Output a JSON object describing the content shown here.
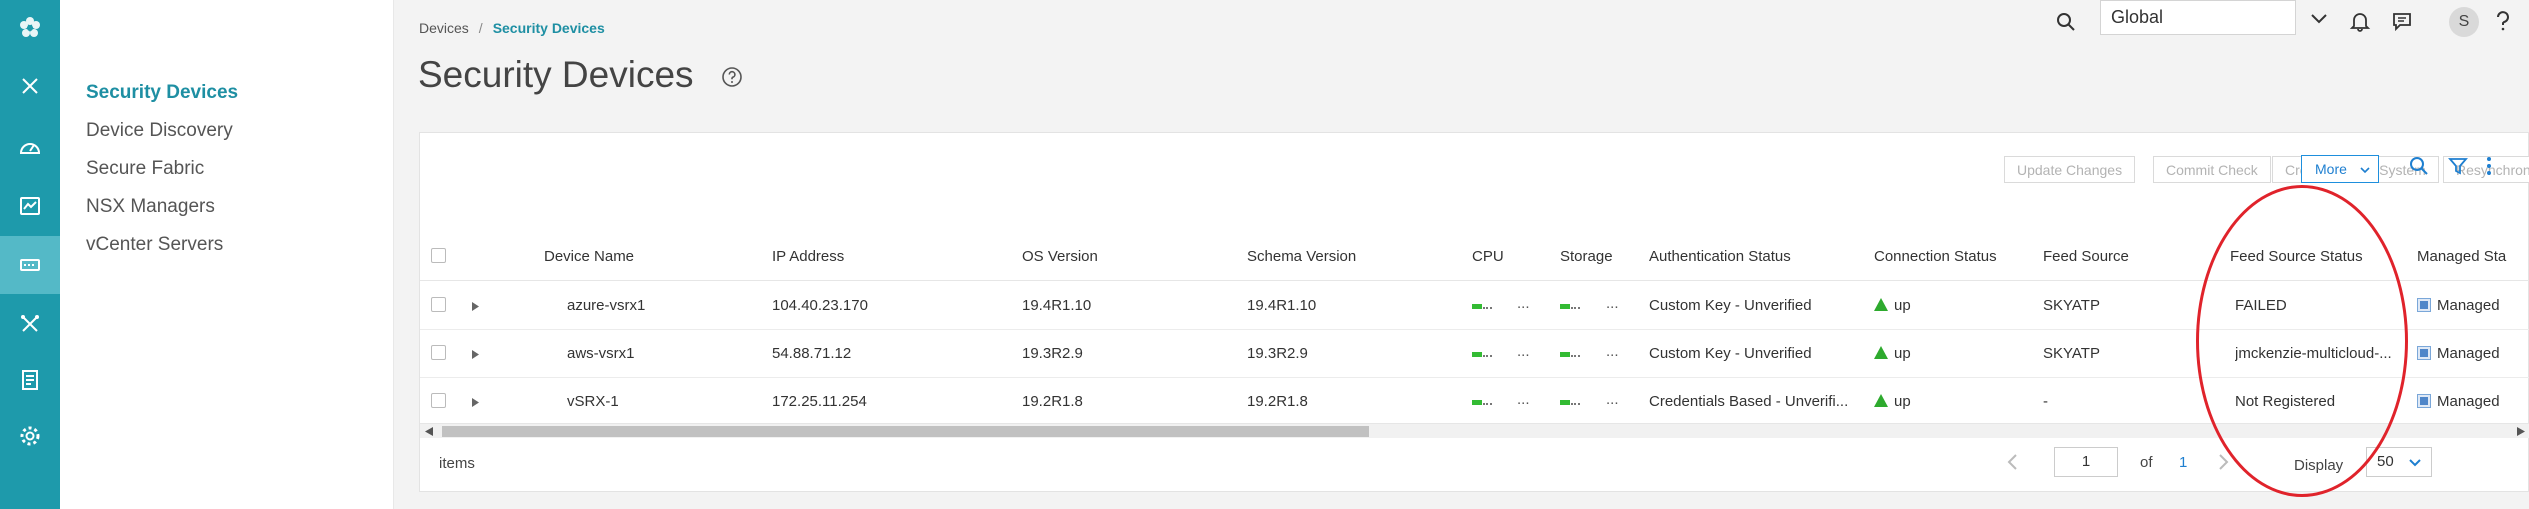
{
  "colors": {
    "rail_bg": "#1e9aab",
    "rail_active": "#54b9c7",
    "accent": "#1e8fa3",
    "link_blue": "#1e7fd0",
    "status_up": "#2eaa2e",
    "annotation_red": "#e0232b"
  },
  "rail": {
    "icons": [
      "flower-logo-icon",
      "close-icon",
      "dashboard-icon",
      "monitor-icon",
      "devices-icon",
      "tools-icon",
      "report-icon",
      "settings-icon"
    ],
    "active_icon": "devices-icon"
  },
  "subnav": {
    "items": [
      {
        "label": "Security Devices",
        "active": true
      },
      {
        "label": "Device Discovery",
        "active": false
      },
      {
        "label": "Secure Fabric",
        "active": false
      },
      {
        "label": "NSX Managers",
        "active": false
      },
      {
        "label": "vCenter Servers",
        "active": false
      }
    ]
  },
  "breadcrumb": {
    "parent": "Devices",
    "separator": "/",
    "current": "Security Devices"
  },
  "page": {
    "title": "Security Devices"
  },
  "topbar": {
    "scope_value": "Global",
    "avatar_initial": "S",
    "icons": [
      "search-icon",
      "chevron-down-icon",
      "bell-icon",
      "messages-icon",
      "help-icon"
    ]
  },
  "toolbar": {
    "update_changes": "Update Changes",
    "commit_check": "Commit Check",
    "create_logical_system": "Create Logical System",
    "resynchronize": "Resynchronize with Network",
    "more": "More"
  },
  "table": {
    "columns": [
      "Device Name",
      "IP Address",
      "OS Version",
      "Schema Version",
      "CPU",
      "Storage",
      "Authentication Status",
      "Connection Status",
      "Feed Source",
      "Feed Source Status",
      "Managed Sta"
    ],
    "rows": [
      {
        "device_name": "azure-vsrx1",
        "ip": "104.40.23.170",
        "os": "19.4R1.10",
        "schema": "19.4R1.10",
        "cpu_more": "...",
        "storage_more": "...",
        "auth": "Custom Key - Unverified",
        "connection": "up",
        "feed_source": "SKYATP",
        "feed_status": "FAILED",
        "managed": "Managed"
      },
      {
        "device_name": "aws-vsrx1",
        "ip": "54.88.71.12",
        "os": "19.3R2.9",
        "schema": "19.3R2.9",
        "cpu_more": "...",
        "storage_more": "...",
        "auth": "Custom Key - Unverified",
        "connection": "up",
        "feed_source": "SKYATP",
        "feed_status": "jmckenzie-multicloud-...",
        "managed": "Managed"
      },
      {
        "device_name": "vSRX-1",
        "ip": "172.25.11.254",
        "os": "19.2R1.8",
        "schema": "19.2R1.8",
        "cpu_more": "...",
        "storage_more": "...",
        "auth": "Credentials Based - Unverifi...",
        "connection": "up",
        "feed_source": "-",
        "feed_status": "Not Registered",
        "managed": "Managed"
      }
    ]
  },
  "footer": {
    "items_label": "items",
    "page_value": "1",
    "of_label": "of",
    "total_pages": "1",
    "display_label": "Display",
    "display_value": "50"
  }
}
